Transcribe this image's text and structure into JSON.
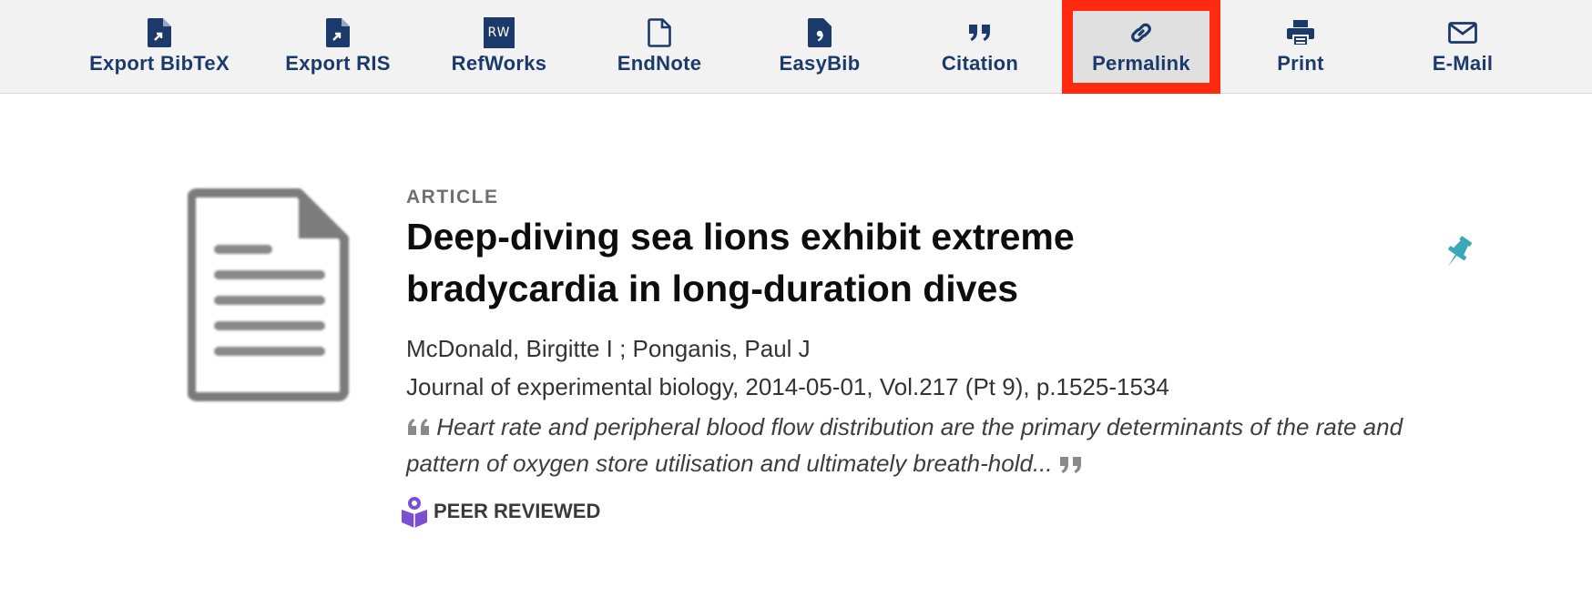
{
  "toolbar": {
    "items": [
      {
        "label": "Export BibTeX",
        "icon": "file-export-icon"
      },
      {
        "label": "Export RIS",
        "icon": "file-export-icon"
      },
      {
        "label": "RefWorks",
        "icon": "refworks-icon",
        "icon_text": "RW"
      },
      {
        "label": "EndNote",
        "icon": "file-icon"
      },
      {
        "label": "EasyBib",
        "icon": "file-comma-icon"
      },
      {
        "label": "Citation",
        "icon": "quote-icon"
      },
      {
        "label": "Permalink",
        "icon": "link-icon",
        "selected": true
      },
      {
        "label": "Print",
        "icon": "printer-icon"
      },
      {
        "label": "E-Mail",
        "icon": "envelope-icon"
      }
    ],
    "highlight_color": "#ff2a0f",
    "label_color": "#1b3a6b"
  },
  "record": {
    "type": "ARTICLE",
    "title": "Deep-diving sea lions exhibit extreme bradycardia in long-duration dives",
    "authors": "McDonald, Birgitte I ; Ponganis, Paul J",
    "source": "Journal of experimental biology, 2014-05-01, Vol.217 (Pt 9), p.1525-1534",
    "snippet": "Heart rate and peripheral blood flow distribution are the primary determinants of the rate and pattern of oxygen store utilisation and ultimately breath-hold...",
    "peer_reviewed": "PEER REVIEWED",
    "thumbnail_icon": "document-icon",
    "pin_icon": "pushpin-icon",
    "pin_color": "#3aa8b8",
    "peer_color": "#7a4fd0"
  }
}
